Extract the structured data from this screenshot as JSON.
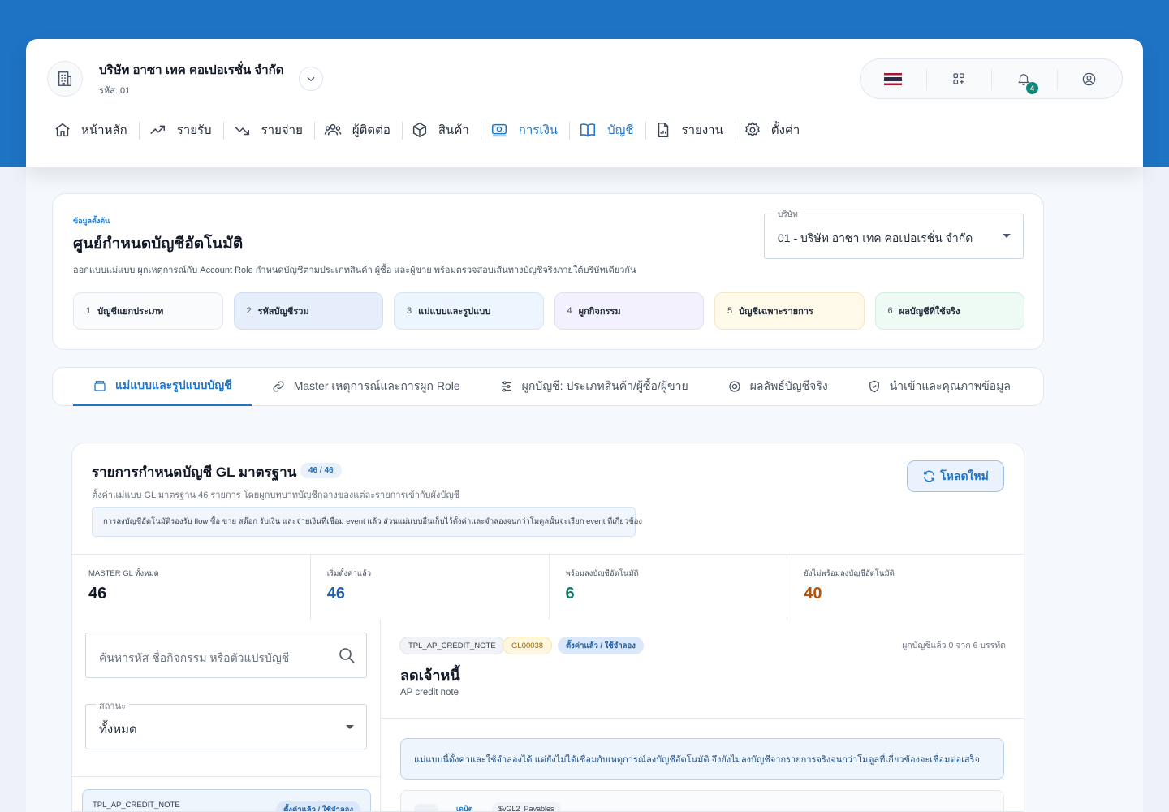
{
  "company": {
    "name": "บริษัท อาซา เทค คอเปอเรชั่น จำกัด",
    "code": "รหัส: 01"
  },
  "toolbar": {
    "notification_count": "4"
  },
  "nav": [
    {
      "label": "หน้าหลัก",
      "icon": "home-icon"
    },
    {
      "label": "รายรับ",
      "icon": "trend-up-icon"
    },
    {
      "label": "รายจ่าย",
      "icon": "trend-down-icon"
    },
    {
      "label": "ผู้ติดต่อ",
      "icon": "contacts-icon"
    },
    {
      "label": "สินค้า",
      "icon": "box-icon"
    },
    {
      "label": "การเงิน",
      "icon": "money-icon",
      "active": true
    },
    {
      "label": "บัญชี",
      "icon": "book-icon"
    },
    {
      "label": "รายงาน",
      "icon": "report-icon"
    },
    {
      "label": "ตั้งค่า",
      "icon": "gear-icon"
    }
  ],
  "setup": {
    "eyebrow": "ข้อมูลตั้งต้น",
    "title": "ศูนย์กำหนดบัญชีอัตโนมัติ",
    "description": "ออกแบบแม่แบบ ผูกเหตุการณ์กับ Account Role กำหนดบัญชีตามประเภทสินค้า ผู้ซื้อ และผู้ขาย พร้อมตรวจสอบเส้นทางบัญชีจริงภายใต้บริษัทเดียวกัน",
    "company_select_label": "บริษัท",
    "company_select_value": "01 - บริษัท อาซา เทค คอเปอเรชั่น จำกัด",
    "steps": [
      {
        "num": "1",
        "label": "บัญชีแยกประเภท"
      },
      {
        "num": "2",
        "label": "รหัสบัญชีรวม"
      },
      {
        "num": "3",
        "label": "แม่แบบและรูปแบบ"
      },
      {
        "num": "4",
        "label": "ผูกกิจกรรม"
      },
      {
        "num": "5",
        "label": "บัญชีเฉพาะรายการ"
      },
      {
        "num": "6",
        "label": "ผลบัญชีที่ใช้จริง"
      }
    ]
  },
  "tabs": [
    {
      "label": "แม่แบบและรูปแบบบัญชี",
      "icon": "folder-icon",
      "active": true
    },
    {
      "label": "Master เหตุการณ์และการผูก Role",
      "icon": "link-icon"
    },
    {
      "label": "ผูกบัญชี: ประเภทสินค้า/ผู้ซื้อ/ผู้ขาย",
      "icon": "sliders-icon"
    },
    {
      "label": "ผลลัพธ์บัญชีจริง",
      "icon": "target-icon"
    },
    {
      "label": "นำเข้าและคุณภาพข้อมูล",
      "icon": "shield-icon"
    }
  ],
  "panel": {
    "title": "รายการกำหนดบัญชี GL มาตรฐาน",
    "count": "46 / 46",
    "subtitle": "ตั้งค่าแม่แบบ GL มาตรฐาน 46 รายการ โดยผูกบทบาทบัญชีกลางของแต่ละรายการเข้ากับผังบัญชี",
    "note": "การลงบัญชีอัตโนมัติรองรับ flow ซื้อ ขาย สต๊อก รับเงิน และจ่ายเงินที่เชื่อม event แล้ว ส่วนแม่แบบอื่นเก็บไว้ตั้งค่าและจำลองจนกว่าโมดูลนั้นจะเรียก event ที่เกี่ยวข้อง",
    "reload_label": "โหลดใหม่",
    "stats": [
      {
        "label": "MASTER GL ทั้งหมด",
        "value": "46",
        "color": "#111827"
      },
      {
        "label": "เริ่มตั้งค่าแล้ว",
        "value": "46",
        "color": "#1d5fb0"
      },
      {
        "label": "พร้อมลงบัญชีอัตโนมัติ",
        "value": "6",
        "color": "#0f7a66"
      },
      {
        "label": "ยังไม่พร้อมลงบัญชีอัตโนมัติ",
        "value": "40",
        "color": "#b45309"
      }
    ],
    "search_placeholder": "ค้นหารหัส ชื่อกิจกรรม หรือตัวแปรบัญชี",
    "status_label": "สถานะ",
    "status_value": "ทั้งหมด",
    "list_item": {
      "code": "TPL_AP_CREDIT_NOTE",
      "status": "ตั้งค่าแล้ว / ใช้จำลอง"
    },
    "detail": {
      "code": "TPL_AP_CREDIT_NOTE",
      "gl": "GL00038",
      "status": "ตั้งค่าแล้ว / ใช้จำลอง",
      "mapping": "ผูกบัญชีแล้ว 0 จาก 6 บรรทัด",
      "title": "ลดเจ้าหนี้",
      "subtitle": "AP credit note",
      "info": "แม่แบบนี้ตั้งค่าและใช้จำลองได้ แต่ยังไม่ได้เชื่อมกับเหตุการณ์ลงบัญชีอัตโนมัติ จึงยังไม่ลงบัญชีจากรายการจริงจนกว่าโมดูลที่เกี่ยวข้องจะเชื่อมต่อเสร็จ",
      "row_side": "เดบิต",
      "row_var": "$vGL2_Payables"
    }
  }
}
